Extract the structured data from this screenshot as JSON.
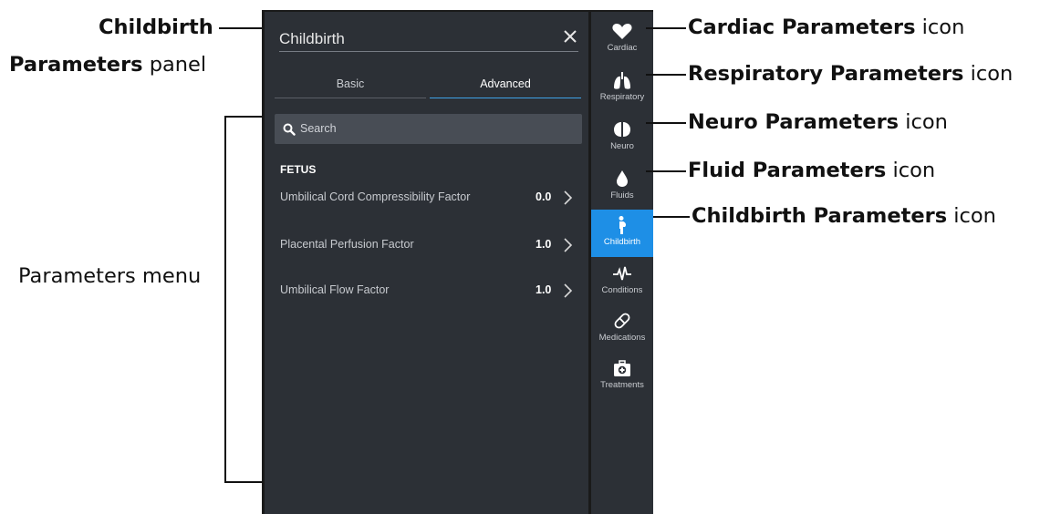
{
  "panel": {
    "title": "Childbirth",
    "tabs": [
      {
        "label": "Basic",
        "active": false
      },
      {
        "label": "Advanced",
        "active": true
      }
    ],
    "search_placeholder": "Search",
    "section_title": "FETUS",
    "params": [
      {
        "name": "Umbilical Cord Compressibility Factor",
        "value": "0.0"
      },
      {
        "name": "Placental Perfusion Factor",
        "value": "1.0"
      },
      {
        "name": "Umbilical Flow Factor",
        "value": "1.0"
      }
    ]
  },
  "sidebar": {
    "items": [
      {
        "label": "Cardiac",
        "icon": "heart-icon"
      },
      {
        "label": "Respiratory",
        "icon": "lungs-icon"
      },
      {
        "label": "Neuro",
        "icon": "brain-icon"
      },
      {
        "label": "Fluids",
        "icon": "drop-icon"
      },
      {
        "label": "Childbirth",
        "icon": "pregnant-icon",
        "active": true
      },
      {
        "label": "Conditions",
        "icon": "pulse-icon"
      },
      {
        "label": "Medications",
        "icon": "pill-icon"
      },
      {
        "label": "Treatments",
        "icon": "medkit-icon"
      }
    ]
  },
  "annotations": {
    "childbirth_panel": {
      "bold1": "Childbirth",
      "bold2": "Parameters",
      "rest": " panel"
    },
    "parameters_menu": "Parameters menu",
    "cardiac": {
      "bold": "Cardiac Parameters",
      "rest": " icon"
    },
    "respiratory": {
      "bold": "Respiratory Parameters",
      "rest": " icon"
    },
    "neuro": {
      "bold": "Neuro Parameters",
      "rest": " icon"
    },
    "fluid": {
      "bold": "Fluid Parameters",
      "rest": " icon"
    },
    "childbirth_icon": {
      "bold": "Childbirth Parameters",
      "rest": " icon"
    }
  },
  "colors": {
    "panel_bg": "#2c3036",
    "accent": "#1e8fe6",
    "search_bg": "#484d55"
  }
}
